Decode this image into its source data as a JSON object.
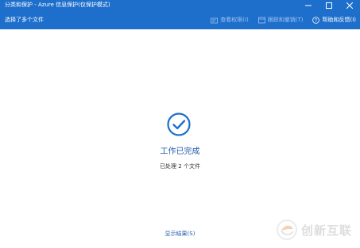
{
  "window": {
    "title": "分类和保护 - Azure 信息保护(仅保护模式)"
  },
  "toolbar": {
    "status": "选择了多个文件",
    "view_permissions": "查看权限(I)",
    "track_and_revoke": "跟踪和撤销(T)",
    "help_feedback": "帮助和反馈(I)"
  },
  "main": {
    "heading": "工作已完成",
    "subtext": "已处理 2 个文件",
    "show_results": "显示结果(S)"
  },
  "watermark": {
    "text": "创新互联"
  },
  "colors": {
    "accent": "#1e6fcc",
    "check": "#1e6fcc",
    "heading": "#1e5aa8"
  }
}
